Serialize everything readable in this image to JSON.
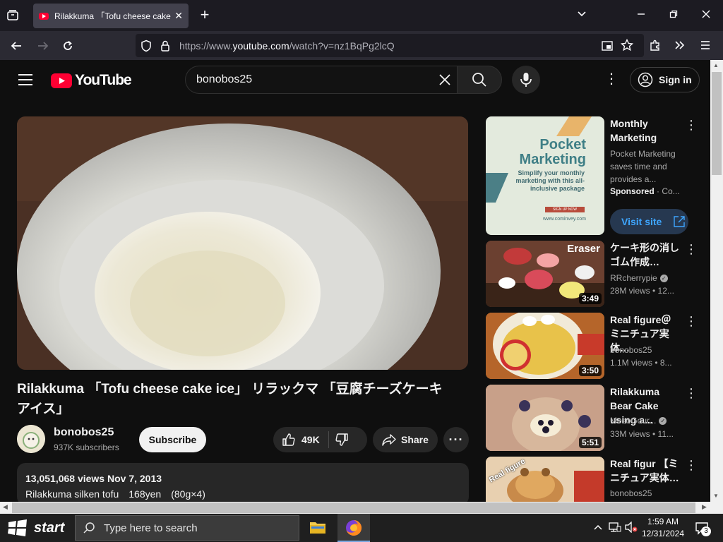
{
  "browser": {
    "tab_title": "Rilakkuma 「Tofu cheese cake ice」 リラックマ 「豆腐チーズケーキアイス」",
    "url_prefix": "https://www.",
    "url_domain": "youtube.com",
    "url_path": "/watch?v=nz1BqPg2lcQ"
  },
  "youtube": {
    "logo_text": "YouTube",
    "search_value": "bonobos25",
    "sign_in": "Sign in"
  },
  "video": {
    "title": "Rilakkuma 「Tofu cheese cake ice」 リラックマ 「豆腐チーズケーキアイス」",
    "channel": "bonobos25",
    "subscribers": "937K subscribers",
    "subscribe_label": "Subscribe",
    "likes": "49K",
    "share_label": "Share",
    "views_date": "13,051,068 views  Nov 7, 2013",
    "description_line": "Rilakkuma silken tofu　168yen　(80g×4)"
  },
  "ad": {
    "title": "Monthly Marketing",
    "description": "Pocket Marketing saves time and provides a...",
    "sponsored": "Sponsored",
    "sponsor_suffix": " · Co...",
    "visit_label": "Visit site",
    "thumb_heading": "Pocket Marketing",
    "thumb_sub": "Simplify your monthly marketing with this all-inclusive package",
    "thumb_button": "SIGN UP NOW",
    "thumb_url": "www.cominvey.com"
  },
  "recommendations": [
    {
      "title": "ケーキ形の消しゴム作成…",
      "channel": "RRcherrypie",
      "meta": "28M views  • 12...",
      "duration": "3:49",
      "overlay": "Eraser",
      "verified": true
    },
    {
      "title": "Real figure＠ミニチュア実体…",
      "channel": "bonobos25",
      "meta": "1.1M views  • 8...",
      "duration": "3:50",
      "verified": false
    },
    {
      "title": "Rilakkuma Bear Cake using a...",
      "channel": "MosoGour...",
      "meta": "33M views  • 11...",
      "duration": "5:51",
      "verified": true
    },
    {
      "title": "Real figur 【ミニチュア実体…",
      "channel": "bonobos25",
      "overlay": "Real figure",
      "verified": false
    }
  ],
  "taskbar": {
    "start_label": "start",
    "search_placeholder": "Type here to search",
    "time": "1:59 AM",
    "date": "12/31/2024",
    "notification_count": "3"
  }
}
